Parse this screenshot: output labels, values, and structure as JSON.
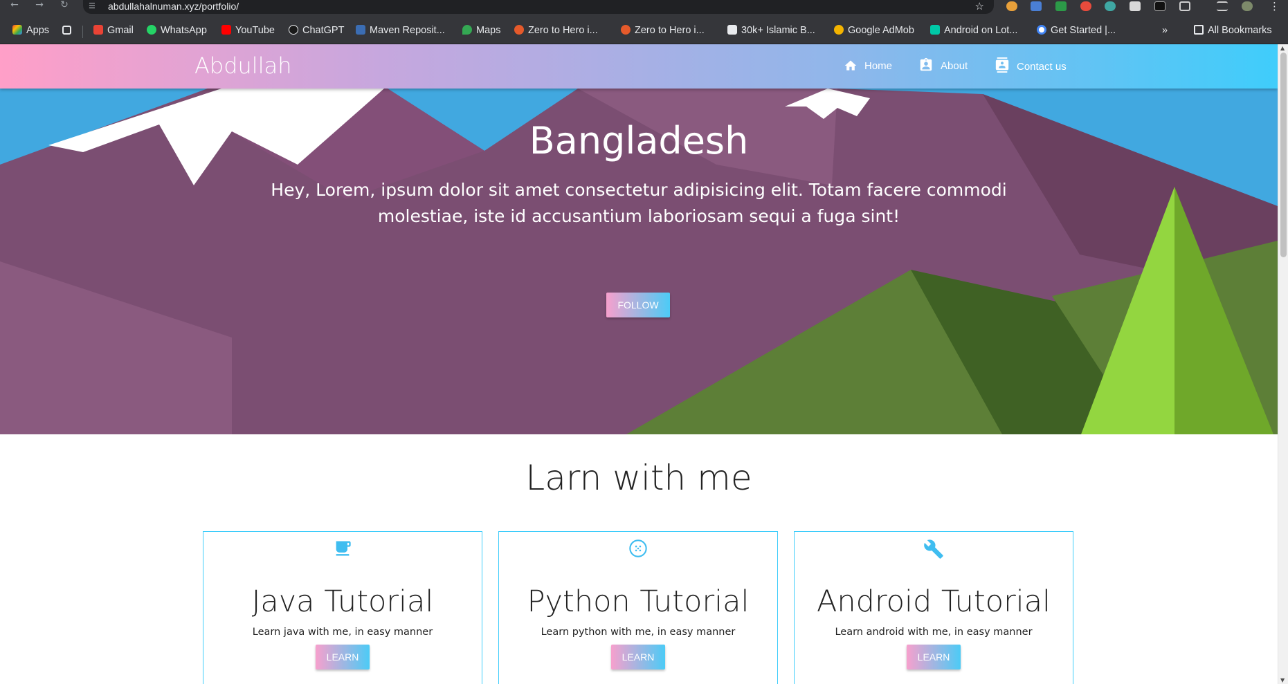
{
  "browser": {
    "url": "abdullahalnuman.xyz/portfolio/",
    "bookmarks": [
      {
        "label": "Apps",
        "icon": "apps-grid-icon"
      },
      {
        "label": "Gmail",
        "icon": "gmail-icon"
      },
      {
        "label": "WhatsApp",
        "icon": "whatsapp-icon"
      },
      {
        "label": "YouTube",
        "icon": "youtube-icon"
      },
      {
        "label": "ChatGPT",
        "icon": "chatgpt-icon"
      },
      {
        "label": "Maven Reposit...",
        "icon": "maven-icon"
      },
      {
        "label": "Maps",
        "icon": "maps-icon"
      },
      {
        "label": "Zero to Hero i...",
        "icon": "udemy-icon"
      },
      {
        "label": "Zero to Hero i...",
        "icon": "udemy-icon"
      },
      {
        "label": "30k+ Islamic B...",
        "icon": "book-icon"
      },
      {
        "label": "Google AdMob",
        "icon": "admob-icon"
      },
      {
        "label": "Android on Lot...",
        "icon": "lottie-icon"
      },
      {
        "label": "Get Started |...",
        "icon": "google-icon"
      }
    ],
    "overflow_label": "»",
    "all_bookmarks_label": "All Bookmarks"
  },
  "navbar": {
    "brand": "Abdullah",
    "items": [
      {
        "label": "Home",
        "icon": "home-icon"
      },
      {
        "label": "About",
        "icon": "about-badge-icon"
      },
      {
        "label": "Contact us",
        "icon": "contact-icon"
      }
    ]
  },
  "hero": {
    "title": "Bangladesh",
    "text": "Hey, Lorem, ipsum dolor sit amet consectetur adipisicing elit. Totam facere commodi molestiae, iste id accusantium laboriosam sequi a fuga sint!",
    "button_label": "FOLLOW"
  },
  "section": {
    "title": "Larn with me"
  },
  "cards": [
    {
      "title": "Java Tutorial",
      "description": "Learn java with me, in easy manner",
      "button_label": "LEARN",
      "icon": "coffee-cup-icon"
    },
    {
      "title": "Python Tutorial",
      "description": "Learn python with me, in easy manner",
      "button_label": "LEARN",
      "icon": "dots-circle-icon"
    },
    {
      "title": "Android Tutorial",
      "description": "Learn android with me, in easy manner",
      "button_label": "LEARN",
      "icon": "wrench-icon"
    }
  ],
  "colors": {
    "gradient_start": "#ff9fc8",
    "gradient_end": "#3fcdfb",
    "sky": "#41a8e0",
    "mountain": "#7b4e72",
    "hill_green": "#5d7f37",
    "tree_green": "#93d640",
    "card_border": "#3fcdfb"
  }
}
